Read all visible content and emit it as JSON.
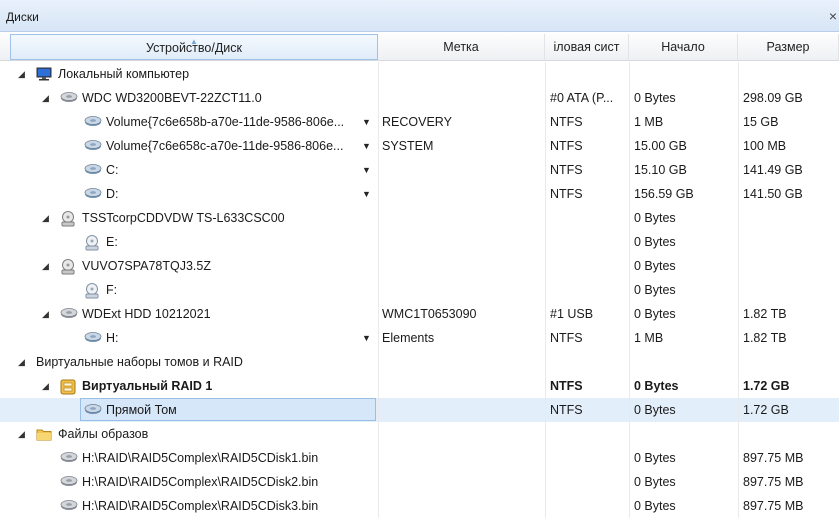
{
  "window": {
    "title": "Диски",
    "close_glyph": "×"
  },
  "columns": [
    {
      "key": "device",
      "label": "Устройство/Диск"
    },
    {
      "key": "label",
      "label": "Метка"
    },
    {
      "key": "fs",
      "label": "іловая сист"
    },
    {
      "key": "start",
      "label": "Начало"
    },
    {
      "key": "size",
      "label": "Размер"
    }
  ],
  "rows": [
    {
      "level": 0,
      "expander": "◢",
      "icon": "computer-icon",
      "device": "Локальный компьютер",
      "label": "",
      "fs": "",
      "start": "",
      "size": ""
    },
    {
      "level": 1,
      "expander": "◢",
      "icon": "hard-disk-icon",
      "device": "WDC WD3200BEVT-22ZCT11.0",
      "label": "",
      "fs": "#0 ATA (P...",
      "start": "0 Bytes",
      "size": "298.09 GB"
    },
    {
      "level": 2,
      "icon": "volume-icon",
      "device": "Volume{7c6e658b-a70e-11de-9586-806e...",
      "dropdown": true,
      "label": "RECOVERY",
      "fs": "NTFS",
      "start": "1 MB",
      "size": "15 GB"
    },
    {
      "level": 2,
      "icon": "volume-icon",
      "device": "Volume{7c6e658c-a70e-11de-9586-806e...",
      "dropdown": true,
      "label": "SYSTEM",
      "fs": "NTFS",
      "start": "15.00 GB",
      "size": "100 MB"
    },
    {
      "level": 2,
      "icon": "volume-icon",
      "device": "C:",
      "dropdown": true,
      "label": "",
      "fs": "NTFS",
      "start": "15.10 GB",
      "size": "141.49 GB"
    },
    {
      "level": 2,
      "icon": "volume-icon",
      "device": "D:",
      "dropdown": true,
      "label": "",
      "fs": "NTFS",
      "start": "156.59 GB",
      "size": "141.50 GB"
    },
    {
      "level": 1,
      "expander": "◢",
      "icon": "optical-drive-icon",
      "device": "TSSTcorpCDDVDW TS-L633CSC00",
      "label": "",
      "fs": "",
      "start": "0 Bytes",
      "size": ""
    },
    {
      "level": 2,
      "icon": "optical-volume-icon",
      "device": "E:",
      "label": "",
      "fs": "",
      "start": "0 Bytes",
      "size": ""
    },
    {
      "level": 1,
      "expander": "◢",
      "icon": "optical-drive-icon",
      "device": "VUVO7SPA78TQJ3.5Z",
      "label": "",
      "fs": "",
      "start": "0 Bytes",
      "size": ""
    },
    {
      "level": 2,
      "icon": "optical-volume-icon",
      "device": "F:",
      "label": "",
      "fs": "",
      "start": "0 Bytes",
      "size": ""
    },
    {
      "level": 1,
      "expander": "◢",
      "icon": "hard-disk-icon",
      "device": "WDExt HDD 10212021",
      "label": "WMC1T0653090",
      "fs": "#1 USB",
      "start": "0 Bytes",
      "size": "1.82 TB"
    },
    {
      "level": 2,
      "icon": "volume-icon",
      "device": "H:",
      "dropdown": true,
      "label": "Elements",
      "fs": "NTFS",
      "start": "1 MB",
      "size": "1.82 TB"
    },
    {
      "level": 0,
      "expander": "◢",
      "icon": "",
      "device": "Виртуальные наборы томов и RAID",
      "label": "",
      "fs": "",
      "start": "",
      "size": ""
    },
    {
      "level": 1,
      "expander": "◢",
      "icon": "raid-icon",
      "device": "Виртуальный RAID 1",
      "bold": true,
      "label": "",
      "fs": "NTFS",
      "start": "0 Bytes",
      "size": "1.72 GB"
    },
    {
      "level": 2,
      "icon": "volume-icon",
      "device": "Прямой Том",
      "selected": true,
      "label": "",
      "fs": "NTFS",
      "start": "0 Bytes",
      "size": "1.72 GB"
    },
    {
      "level": 0,
      "expander": "◢",
      "icon": "folder-icon",
      "device": "Файлы образов",
      "label": "",
      "fs": "",
      "start": "",
      "size": ""
    },
    {
      "level": 1,
      "icon": "disk-image-icon",
      "device": "H:\\RAID\\RAID5Complex\\RAID5CDisk1.bin",
      "label": "",
      "fs": "",
      "start": "0 Bytes",
      "size": "897.75 MB"
    },
    {
      "level": 1,
      "icon": "disk-image-icon",
      "device": "H:\\RAID\\RAID5Complex\\RAID5CDisk2.bin",
      "label": "",
      "fs": "",
      "start": "0 Bytes",
      "size": "897.75 MB"
    },
    {
      "level": 1,
      "icon": "disk-image-icon",
      "device": "H:\\RAID\\RAID5Complex\\RAID5CDisk3.bin",
      "label": "",
      "fs": "",
      "start": "0 Bytes",
      "size": "897.75 MB"
    }
  ]
}
